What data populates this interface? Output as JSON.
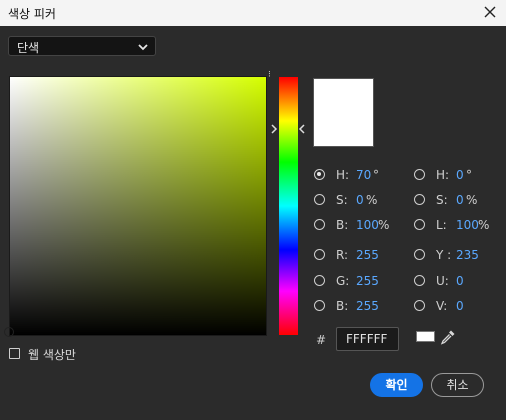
{
  "window": {
    "title": "색상 피커"
  },
  "mode_select": {
    "value": "단색"
  },
  "color_fields": {
    "h": {
      "label": "H:",
      "value": "70",
      "unit": "°"
    },
    "s": {
      "label": "S:",
      "value": "0",
      "unit": "%"
    },
    "b": {
      "label": "B:",
      "value": "100",
      "unit": "%"
    },
    "r": {
      "label": "R:",
      "value": "255"
    },
    "g": {
      "label": "G:",
      "value": "255"
    },
    "bb": {
      "label": "B:",
      "value": "255"
    },
    "h2": {
      "label": "H:",
      "value": "0",
      "unit": "°"
    },
    "s2": {
      "label": "S:",
      "value": "0",
      "unit": "%"
    },
    "l": {
      "label": "L:",
      "value": "100",
      "unit": "%"
    },
    "y": {
      "label": "Y :",
      "value": "235"
    },
    "u": {
      "label": "U:",
      "value": "0"
    },
    "v": {
      "label": "V:",
      "value": "0"
    }
  },
  "hex": {
    "hash": "#",
    "value": "FFFFFF"
  },
  "websafe": {
    "label": "웹 색상만"
  },
  "buttons": {
    "ok": "확인",
    "cancel": "취소"
  },
  "colors": {
    "accent": "#1473e6",
    "value_blue": "#5aa8ff",
    "current_color": "#ffffff",
    "hue_color": "#d6ff00"
  },
  "icons": [
    "close-icon",
    "chevron-down-icon",
    "eyedropper-icon"
  ]
}
